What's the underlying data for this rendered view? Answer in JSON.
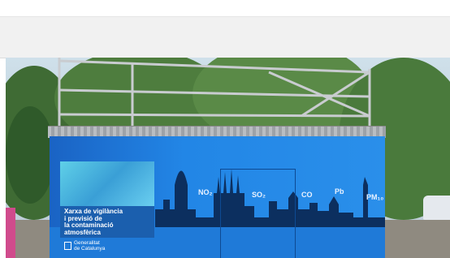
{
  "sign": {
    "line1": "Xarxa de vigilància",
    "line2": "i previsió de",
    "line3": "la contaminació",
    "line4": "atmosfèrica"
  },
  "pollutants": [
    "NO₂",
    "SO₂",
    "CO",
    "Pb",
    "PM₁₀"
  ],
  "logo": {
    "line1": "Generalitat",
    "line2": "de Catalunya"
  },
  "colors": {
    "container_blue": "#2286e6",
    "greybar": "#f1f1f1"
  }
}
